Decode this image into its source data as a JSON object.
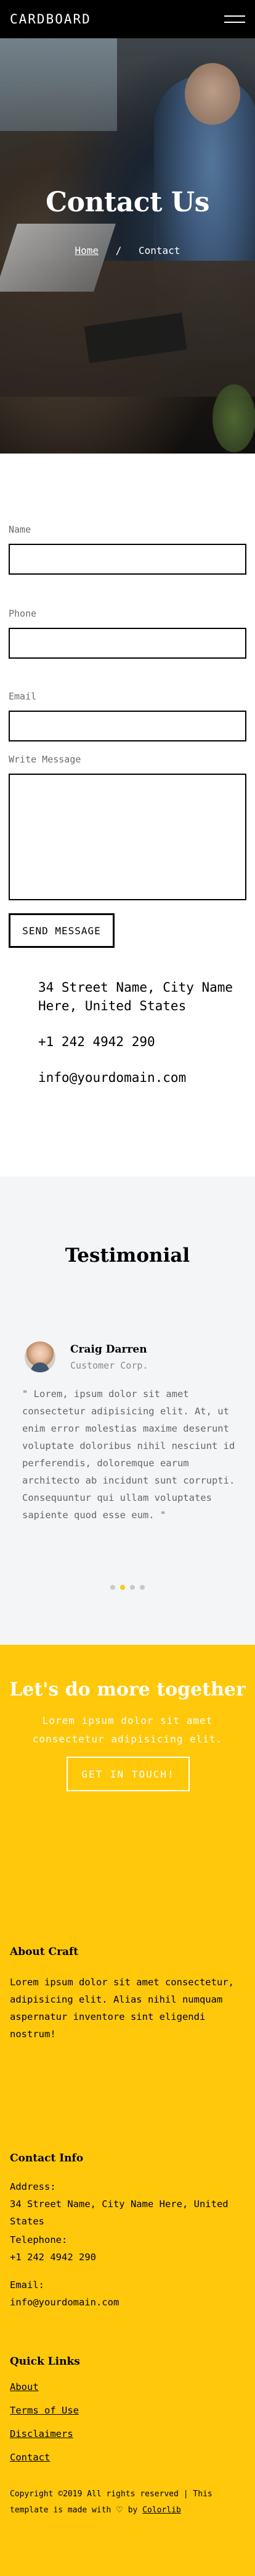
{
  "navbar": {
    "brand": "CARDBOARD"
  },
  "hero": {
    "title": "Contact Us",
    "breadcrumb": {
      "home": "Home",
      "separator": "/",
      "current": "Contact"
    }
  },
  "form": {
    "name_label": "Name",
    "name_value": "",
    "phone_label": "Phone",
    "phone_value": "",
    "email_label": "Email",
    "email_value": "",
    "message_label": "Write Message",
    "message_value": "",
    "submit_label": "SEND MESSAGE"
  },
  "contact": {
    "address": "34 Street Name, City Name Here, United States",
    "phone": "+1 242 4942 290",
    "email": "info@yourdomain.com"
  },
  "testimonial": {
    "heading": "Testimonial",
    "name": "Craig Darren",
    "role": "Customer Corp.",
    "quote": "\" Lorem, ipsum dolor sit amet consectetur adipisicing elit. At, ut enim error molestias maxime deserunt voluptate doloribus nihil nesciunt id perferendis, doloremque earum architecto ab incidunt sunt corrupti. Consequuntur qui ullam voluptates sapiente quod esse eum. \"",
    "dots": 4,
    "active_dot": 2
  },
  "cta": {
    "heading": "Let's do more together",
    "subtext": "Lorem ipsum dolor sit amet consectetur adipisicing elit.",
    "button": "GET IN TOUCH!"
  },
  "footer": {
    "about_heading": "About Craft",
    "about_text": "Lorem ipsum dolor sit amet consectetur, adipisicing elit. Alias nihil numquam aspernatur inventore sint eligendi nostrum!",
    "contact_heading": "Contact Info",
    "address_label": "Address:",
    "address_value": "34 Street Name, City Name Here, United States",
    "telephone_label": "Telephone:",
    "telephone_value": "+1 242 4942 290",
    "email_label": "Email:",
    "email_value": "info@yourdomain.com",
    "links_heading": "Quick Links",
    "links": [
      "About",
      "Terms of Use",
      "Disclaimers",
      "Contact"
    ],
    "copyright_pre": "Copyright ©2019 All rights reserved | This template is made with",
    "copyright_by": "by",
    "copyright_link": "Colorlib"
  },
  "colors": {
    "accent": "#ffc80a",
    "dark": "#000000",
    "testimonial_bg": "#f4f5f7"
  },
  "icons": {
    "menu": "hamburger-icon",
    "heart": "heart-icon"
  }
}
